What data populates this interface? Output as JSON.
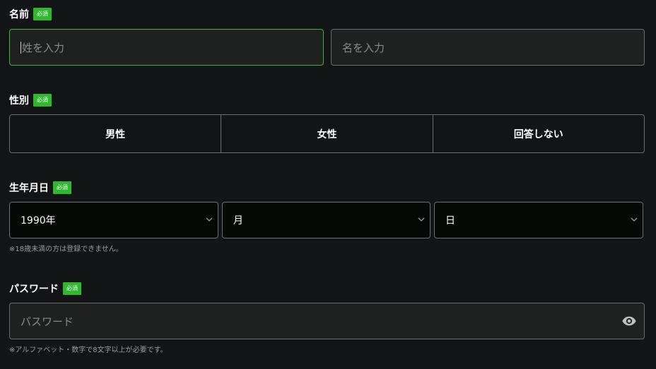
{
  "name": {
    "label": "名前",
    "required_badge": "必須",
    "last_name_placeholder": "姓を入力",
    "first_name_placeholder": "名を入力"
  },
  "gender": {
    "label": "性別",
    "required_badge": "必須",
    "options": [
      "男性",
      "女性",
      "回答しない"
    ]
  },
  "birthdate": {
    "label": "生年月日",
    "required_badge": "必須",
    "year_value": "1990年",
    "month_value": "月",
    "day_value": "日",
    "note": "※18歳未満の方は登録できません。"
  },
  "password": {
    "label": "パスワード",
    "required_badge": "必須",
    "placeholder": "パスワード",
    "note": "※アルファベット・数字で8文字以上が必要です。"
  },
  "icons": {
    "select_chevron": "chevron-down-icon",
    "password_toggle": "eye-icon"
  },
  "colors": {
    "background": "#121415",
    "accent_green": "#2eb82e",
    "border": "#6c6e6d",
    "focus_border": "#3db53d"
  }
}
